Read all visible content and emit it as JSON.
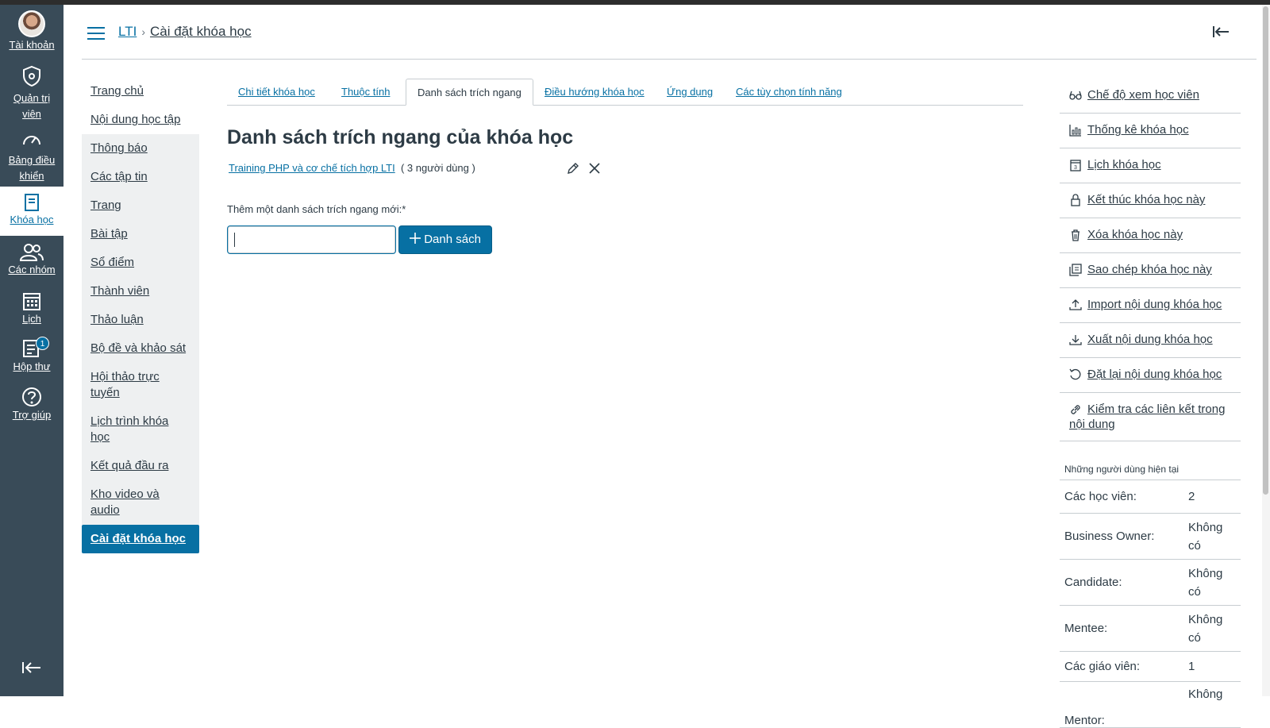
{
  "global_nav": {
    "account": "Tài khoản",
    "admin": "Quản trị viên",
    "dashboard": "Bảng điều khiển",
    "courses": "Khóa học",
    "groups": "Các nhóm",
    "calendar": "Lịch",
    "inbox": "Hộp thư",
    "inbox_badge": "1",
    "help": "Trợ giúp"
  },
  "header": {
    "breadcrumb_root": "LTI",
    "breadcrumb_current": "Cài đặt khóa học"
  },
  "course_nav": [
    "Trang chủ",
    "Nội dung học tập",
    "Thông báo",
    "Các tập tin",
    "Trang",
    "Bài tập",
    "Sổ điểm",
    "Thành viên",
    "Thảo luận",
    "Bộ đề và khảo sát",
    "Hội thảo trực tuyến",
    "Lịch trình khóa học",
    "Kết quả đầu ra",
    "Kho video và audio",
    "Cài đặt khóa học"
  ],
  "tabs": [
    "Chi tiết khóa học",
    "Thuộc tính",
    "Danh sách trích ngang",
    "Điều hướng khóa học",
    "Ứng dụng",
    "Các tùy chọn tính năng"
  ],
  "main": {
    "title": "Danh sách trích ngang của khóa học",
    "section_link": "Training PHP và cơ chế tích hợp LTI",
    "section_count": "( 3 người dùng )",
    "add_label": "Thêm một danh sách trích ngang mới:*",
    "add_input_value": "",
    "add_button": "Danh sách"
  },
  "right_actions": [
    "Chế độ xem học viên",
    "Thống kê khóa học",
    "Lịch khóa học",
    "Kết thúc khóa học này",
    "Xóa khóa học này",
    "Sao chép khóa học này",
    "Import nội dung khóa học",
    "Xuất nội dung khóa học",
    "Đặt lại nội dung khóa học",
    "Kiểm tra các liên kết trong nội dung"
  ],
  "current_users": {
    "heading": "Những người dùng hiện tại",
    "rows": [
      {
        "role": "Các học viên:",
        "count": "2"
      },
      {
        "role": "Business Owner:",
        "count": "Không có"
      },
      {
        "role": "Candidate:",
        "count": "Không có"
      },
      {
        "role": "Mentee:",
        "count": "Không có"
      },
      {
        "role": "Các giáo viên:",
        "count": "1"
      },
      {
        "role": "Mentor:",
        "count": "Không"
      }
    ]
  }
}
